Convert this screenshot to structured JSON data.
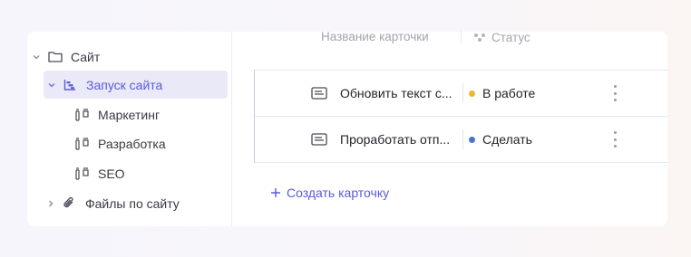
{
  "tree": {
    "root": {
      "label": "Сайт",
      "icon": "folder-icon"
    },
    "active": {
      "label": "Запуск сайта",
      "icon": "board-icon"
    },
    "children": [
      {
        "label": "Маркетинг",
        "icon": "columns-icon"
      },
      {
        "label": "Разработка",
        "icon": "columns-icon"
      },
      {
        "label": "SEO",
        "icon": "columns-icon"
      }
    ],
    "files": {
      "label": "Файлы по сайту",
      "icon": "paperclip-icon"
    }
  },
  "table": {
    "col_title": "Название карточки",
    "col_status": "Статус",
    "rows": [
      {
        "title": "Обновить текст с...",
        "status": "В работе",
        "status_color": "#e8b92a",
        "icon": "card-icon"
      },
      {
        "title": "Проработать отп...",
        "status": "Сделать",
        "status_color": "#4a74c9",
        "icon": "card-icon"
      }
    ]
  },
  "create_label": "Создать карточку",
  "colors": {
    "accent": "#5a5bd6",
    "active_bg": "#e9e9f8"
  }
}
